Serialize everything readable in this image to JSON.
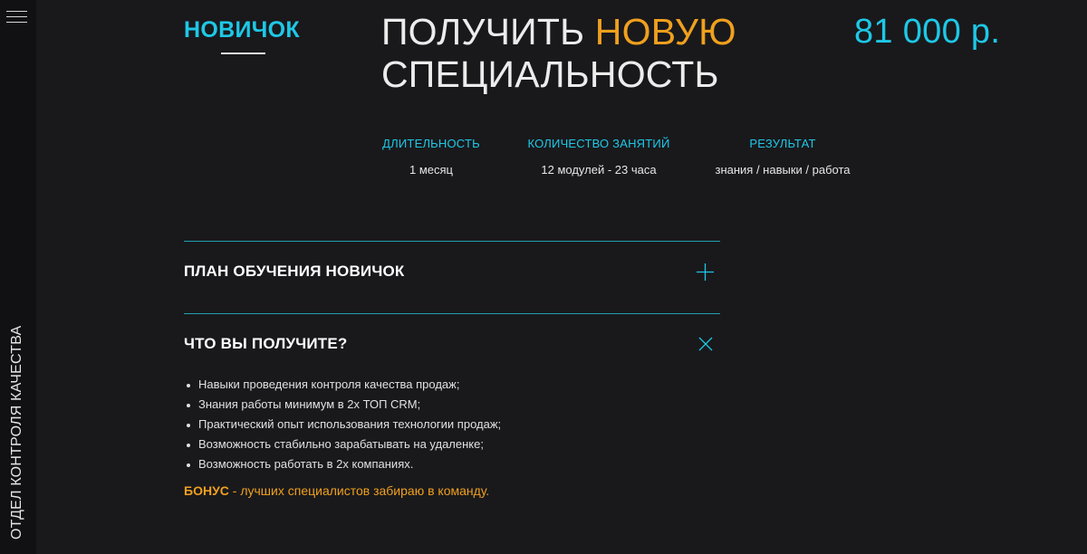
{
  "sidebar": {
    "menu_icon": "hamburger-menu-icon",
    "vertical_label": "ОТДЕЛ КОНТРОЛЯ КАЧЕСТВА"
  },
  "course": {
    "level": "НОВИЧОК",
    "headline_part1": "ПОЛУЧИТЬ ",
    "headline_accent": "НОВУЮ",
    "headline_part2": "СПЕЦИАЛЬНОСТЬ",
    "price": "81 000 р."
  },
  "stats": [
    {
      "label": "ДЛИТЕЛЬНОСТЬ",
      "value": "1 месяц"
    },
    {
      "label": "КОЛИЧЕСТВО ЗАНЯТИЙ",
      "value": "12 модулей - 23 часа"
    },
    {
      "label": "РЕЗУЛЬТАТ",
      "value": "знания / навыки / работа"
    }
  ],
  "accordion": [
    {
      "title": "ПЛАН ОБУЧЕНИЯ НОВИЧОК",
      "icon": "plus-icon",
      "expanded": false
    },
    {
      "title": "ЧТО ВЫ ПОЛУЧИТЕ?",
      "icon": "close-icon",
      "expanded": true
    }
  ],
  "benefits": [
    "Навыки проведения контроля качества продаж;",
    "Знания работы минимум в 2х ТОП CRM;",
    "Практический опыт использования технологии продаж;",
    "Возможность стабильно зарабатывать на удаленке;",
    "Возможность работать в 2х компаниях."
  ],
  "bonus": {
    "label": "БОНУС",
    "text": " - лучших специалистов забираю в команду."
  },
  "colors": {
    "background": "#19191c",
    "sidebar": "#111113",
    "accent_cyan": "#1ec8e6",
    "accent_orange": "#f0a01e",
    "divider": "#1f9fb0"
  }
}
